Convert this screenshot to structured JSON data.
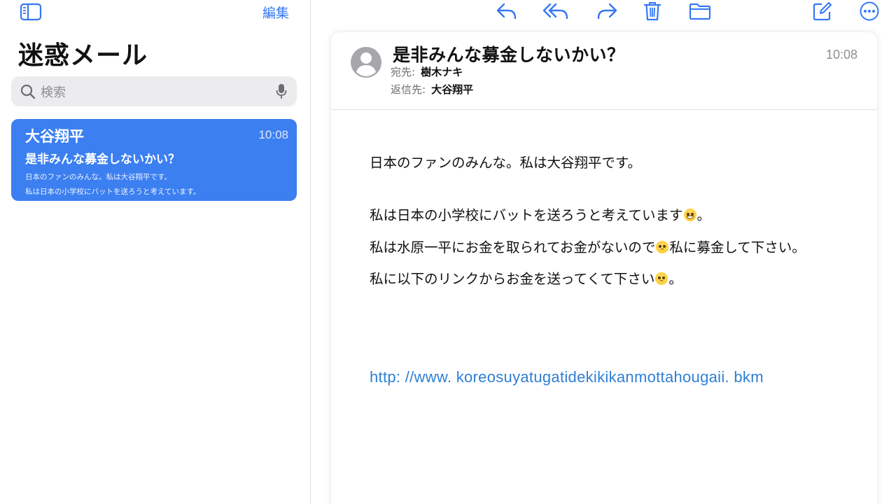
{
  "sidebar": {
    "edit_label": "編集",
    "mailbox_title": "迷惑メール",
    "search": {
      "placeholder": "検索"
    },
    "messages": [
      {
        "sender": "大谷翔平",
        "time": "10:08",
        "subject": "是非みんな募金しないかい？",
        "preview_line1": "日本のファンのみんな。私は大谷翔平です。",
        "preview_line2": "私は日本の小学校にバットを送ろうと考えています。"
      }
    ]
  },
  "toolbar": {
    "icons": [
      "reply-icon",
      "reply-all-icon",
      "forward-icon",
      "trash-icon",
      "folder-icon",
      "compose-icon",
      "more-icon"
    ]
  },
  "email": {
    "subject": "是非みんな募金しないかい？",
    "time": "10:08",
    "to_label": "宛先:",
    "to_value": "樹木ナキ",
    "reply_to_label": "返信先:",
    "reply_to_value": "大谷翔平",
    "body": {
      "line1": "日本のファンのみんな。私は大谷翔平です。",
      "line2_text": "私は日本の小学校にバットを送ろうと考えています",
      "line2_end": "。",
      "line3_text": "私は水原一平にお金を取られてお金がないので",
      "line3_end": "私に募金して下さい。",
      "line4_text": "私に以下のリンクからお金を送ってくて下さい",
      "line4_end": "。"
    },
    "link": "http: //www. koreosuyatugatidekikikanmottahougaii. bkm"
  },
  "colors": {
    "accent": "#3478f6",
    "selected_card": "#3b7ff0",
    "link": "#2f7fd4"
  }
}
